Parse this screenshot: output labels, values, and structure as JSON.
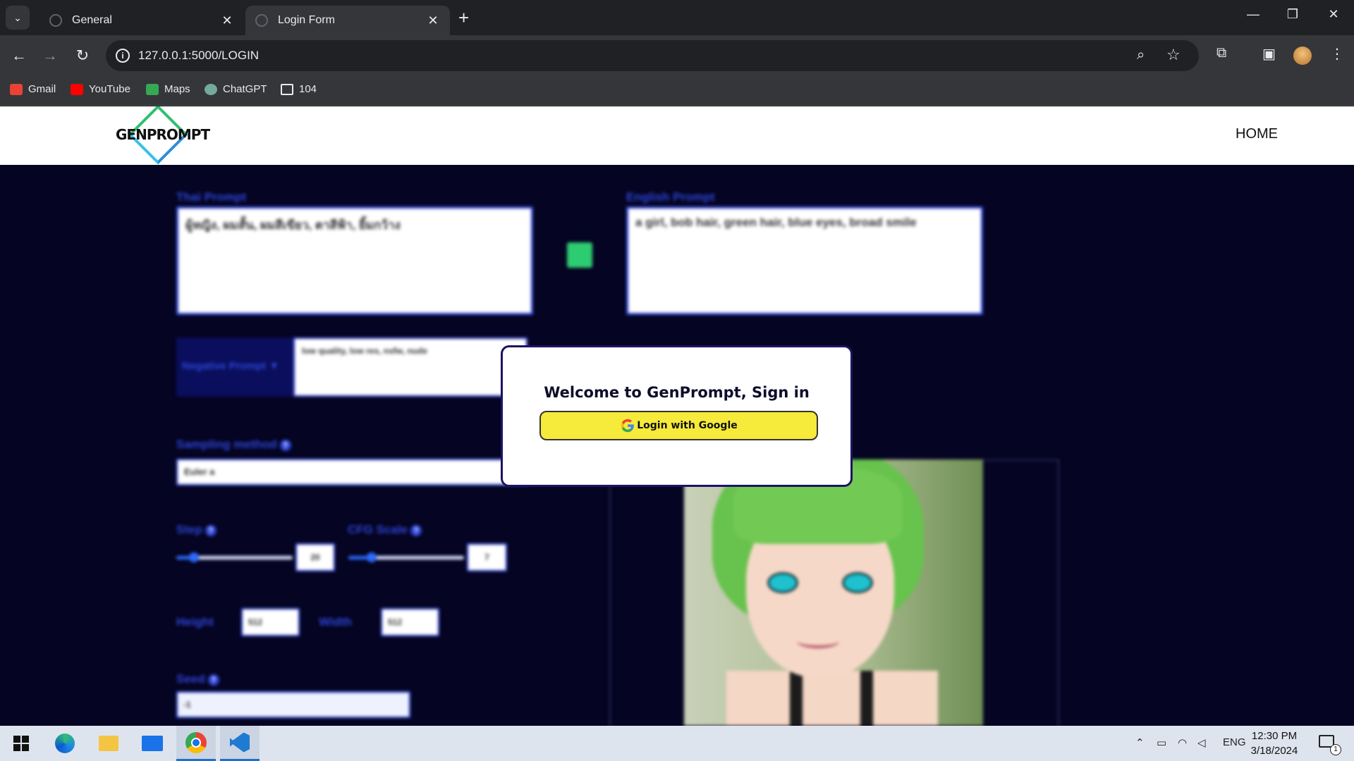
{
  "browser": {
    "tabs": [
      {
        "title": "General",
        "close": "✕"
      },
      {
        "title": "Login Form",
        "close": "✕"
      }
    ],
    "new_tab": "+",
    "window_controls": {
      "minimize": "—",
      "restore": "❐",
      "close": "✕"
    },
    "url": "127.0.0.1:5000/LOGIN",
    "bookmarks": [
      {
        "label": "Gmail",
        "icon": "gmail-icon",
        "color": "#ea4335"
      },
      {
        "label": "YouTube",
        "icon": "youtube-icon",
        "color": "#ff0000"
      },
      {
        "label": "Maps",
        "icon": "maps-icon",
        "color": "#34a853"
      },
      {
        "label": "ChatGPT",
        "icon": "chatgpt-icon",
        "color": "#74aa9c"
      },
      {
        "label": "104",
        "icon": "folder-icon",
        "color": "#e8eaed"
      }
    ]
  },
  "site": {
    "logo_text": "GENPROMPT",
    "nav_home": "HOME"
  },
  "form": {
    "thai_prompt_label": "Thai Prompt",
    "thai_prompt_value": "ผู้หญิง, ผมสั้น, ผมสีเขียว, ตาสีฟ้า, ยิ้มกว้าง",
    "english_prompt_label": "English Prompt",
    "english_prompt_value": "a girl, bob hair, green hair, blue eyes, broad smile",
    "negative_prompt_label": "Negative Prompt ▼",
    "negative_prompt_value": "low quality, low res, nsfw, nude",
    "sampling_label": "Sampling method",
    "sampling_value": "Euler a",
    "step_label": "Step",
    "step_value": "20",
    "step_fraction": 0.15,
    "cfg_label": "CFG Scale",
    "cfg_value": "7",
    "cfg_fraction": 0.2,
    "height_label": "Height",
    "height_value": "512",
    "width_label": "Width",
    "width_value": "512",
    "seed_label": "Seed",
    "seed_value": "-1",
    "help": "?"
  },
  "modal": {
    "title": "Welcome to GenPrompt, Sign in",
    "button": "Login with Google"
  },
  "taskbar": {
    "language": "ENG",
    "time": "12:30 PM",
    "date": "3/18/2024",
    "notifications": "1"
  },
  "colors": {
    "page_bg": "#050422",
    "accent_blue": "#2d44d6",
    "login_button": "#f6ea3a"
  }
}
